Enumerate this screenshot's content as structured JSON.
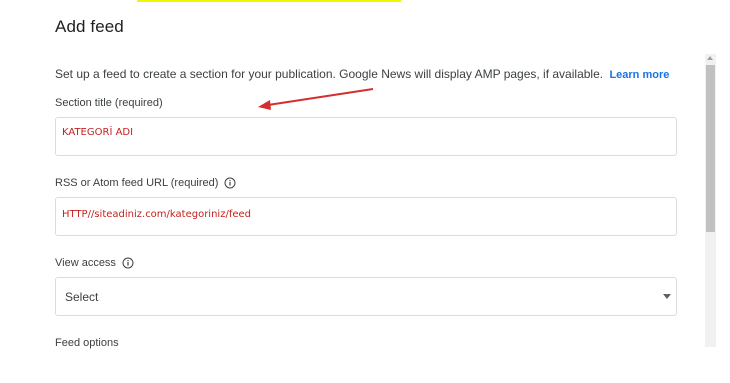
{
  "dialog": {
    "title": "Add feed",
    "intro_text": "Set up a feed to create a section for your publication. Google News will display AMP pages, if available.",
    "learn_more": "Learn more"
  },
  "section_title": {
    "label": "Section title (required)",
    "value": "KATEGORİ ADI"
  },
  "feed_url": {
    "label": "RSS or Atom feed URL (required)",
    "value": "HTTP//siteadiniz.com/kategoriniz/feed",
    "info_icon": "info-icon"
  },
  "view_access": {
    "label": "View access",
    "selected": "Select",
    "info_icon": "info-icon"
  },
  "feed_options": {
    "label": "Feed options"
  },
  "colors": {
    "accent": "#1a73e8",
    "annotation": "#d32f2f",
    "field_text": "#c5221f",
    "highlight": "#f5f500"
  }
}
